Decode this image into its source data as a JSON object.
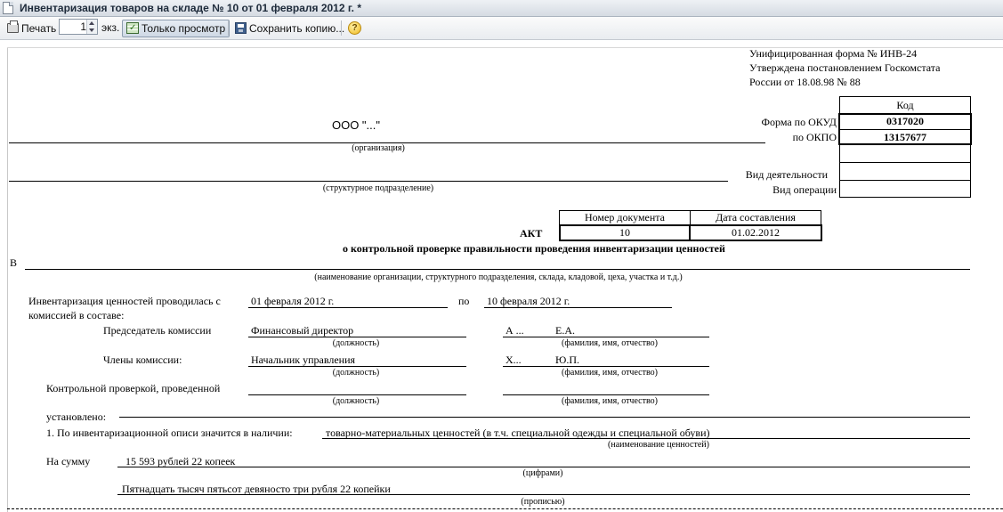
{
  "window": {
    "title": "Инвентаризация товаров на складе № 10 от 01 февраля 2012 г. *"
  },
  "toolbar": {
    "print_label": "Печать",
    "copies_value": "1",
    "copies_unit": "экз.",
    "view_only_label": "Только просмотр",
    "save_copy_label": "Сохранить копию...",
    "help_glyph": "?"
  },
  "form": {
    "header_lines": [
      "Унифицированная форма № ИНВ-24",
      "Утверждена постановлением Госкомстата",
      "России от 18.08.98  № 88"
    ],
    "code_header": "Код",
    "okud_label": "Форма по ОКУД",
    "okud_value": "0317020",
    "okpo_label": "по ОКПО",
    "okpo_value": "13157677",
    "activity_label": "Вид деятельности",
    "operation_label": "Вид операции",
    "organization_value": "ООО \"...\"",
    "organization_caption": "(организация)",
    "division_caption": "(структурное подразделение)",
    "doc_number_header": "Номер документа",
    "doc_date_header": "Дата составления",
    "doc_number_value": "10",
    "doc_date_value": "01.02.2012",
    "act_title": "АКТ",
    "act_subtitle": "о контрольной проверке правильности проведения инвентаризации ценностей",
    "in_prefix": "В",
    "place_caption": "(наименование организации, структурного подразделения, склада, кладовой, цеха, участка и т.д.)",
    "period_label": "Инвентаризация ценностей проводилась с",
    "period_start": "01 февраля 2012 г.",
    "period_to": "по",
    "period_end": "10 февраля 2012 г.",
    "commission_label": "комиссией в составе:",
    "chairman_label": "Председатель комиссии",
    "chairman_position": "Финансовый директор",
    "chairman_surname": "А ...",
    "chairman_initials": "Е.А.",
    "position_caption": "(должность)",
    "name_caption": "(фамилия, имя, отчество)",
    "members_label": "Члены комиссии:",
    "member_position": "Начальник управления",
    "member_surname": "Х...",
    "member_initials": "Ю.П.",
    "control_label": "Контрольной проверкой, проведенной",
    "established_label": "установлено:",
    "item1_label": "1.   По инвентаризационной описи значится в наличии:",
    "item1_value": "товарно-материальных ценностей (в т.ч. специальной одежды и специальной обуви)",
    "values_caption": "(наименование ценностей)",
    "sum_label": "На сумму",
    "sum_digits": "15 593 рублей 22 копеек",
    "digits_caption": "(цифрами)",
    "sum_words": "Пятнадцать тысяч пятьсот девяносто три рубля 22 копейки",
    "words_caption": "(прописью)"
  }
}
